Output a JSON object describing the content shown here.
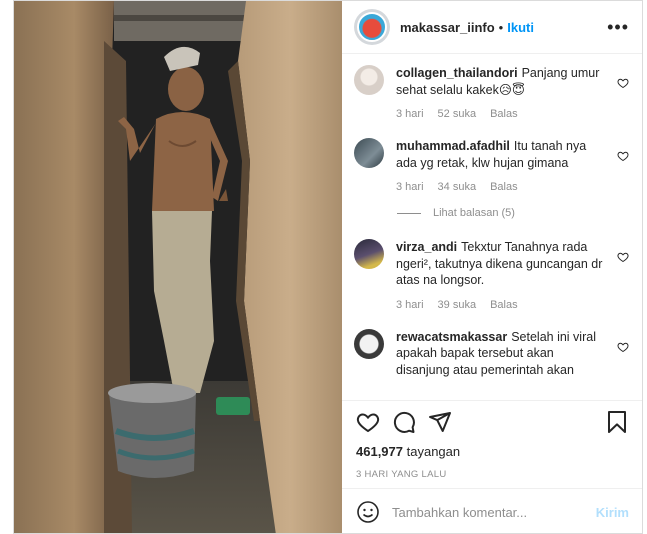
{
  "post": {
    "username": "makassar_iinfo",
    "separator": "•",
    "follow_label": "Ikuti",
    "more_label": "•••"
  },
  "comments": [
    {
      "user": "collagen_thailandori",
      "text": "Panjang umur sehat selalu kakek😥😇",
      "time": "3 hari",
      "likes": "52 suka",
      "reply": "Balas"
    },
    {
      "user": "muhammad.afadhil",
      "text": "Itu tanah nya ada yg retak, klw hujan gimana",
      "time": "3 hari",
      "likes": "34 suka",
      "reply": "Balas",
      "view_replies": "Lihat balasan (5)"
    },
    {
      "user": "virza_andi",
      "text": "Tekxtur Tanahnya rada ngeri², takutnya dikena guncangan dr atas na longsor.",
      "time": "3 hari",
      "likes": "39 suka",
      "reply": "Balas"
    },
    {
      "user": "rewacatsmakassar",
      "text": "Setelah ini viral apakah bapak tersebut akan disanjung atau pemerintah akan"
    }
  ],
  "stats": {
    "views_count": "461,977",
    "views_label": "tayangan",
    "date": "3 HARI YANG LALU"
  },
  "add_comment": {
    "placeholder": "Tambahkan komentar...",
    "post_label": "Kirim"
  },
  "icons": {
    "like": "heart-icon",
    "comment": "comment-icon",
    "share": "share-icon",
    "save": "bookmark-icon",
    "emoji": "emoji-icon",
    "more": "more-icon"
  },
  "colors": {
    "accent": "#0095f6",
    "post_button_disabled": "#b2dffc",
    "meta_text": "#8e8e8e"
  }
}
